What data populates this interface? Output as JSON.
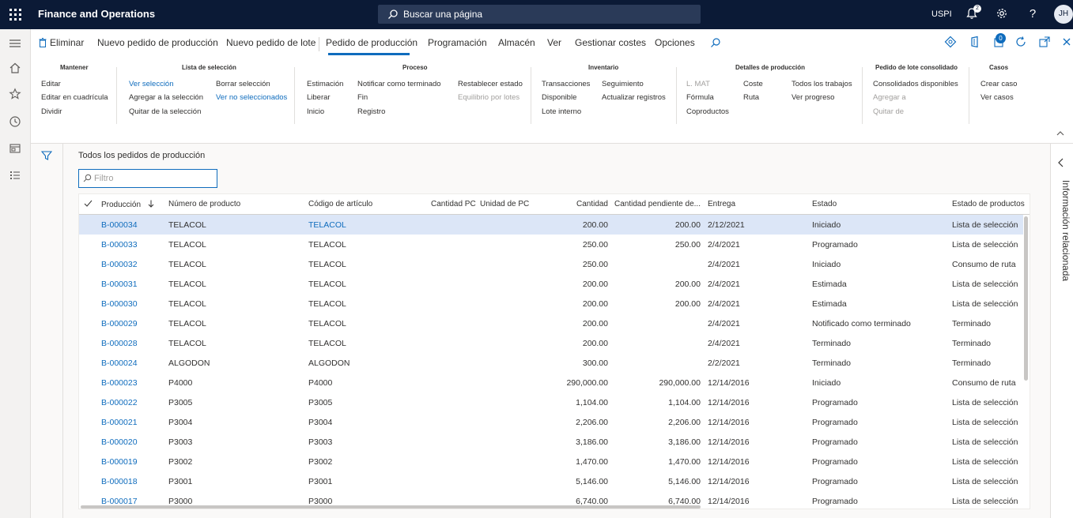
{
  "topbar": {
    "app_title": "Finance and Operations",
    "search_placeholder": "Buscar una página",
    "company": "USPI",
    "notification_count": "2",
    "avatar_initials": "JH"
  },
  "actionpane": {
    "tabs": [
      "Eliminar",
      "Nuevo pedido de producción",
      "Nuevo pedido de lote",
      "Pedido de producción",
      "Programación",
      "Almacén",
      "Ver",
      "Gestionar costes",
      "Opciones"
    ],
    "active_tab": "Pedido de producción",
    "badge_count": "0",
    "groups": {
      "mantener": {
        "title": "Mantener",
        "items": [
          "Editar",
          "Editar en cuadrícula",
          "Dividir"
        ]
      },
      "lista": {
        "title": "Lista de selección",
        "items": [
          "Ver selección",
          "Agregar a la selección",
          "Quitar de la selección",
          "Borrar selección",
          "Ver no seleccionados"
        ]
      },
      "proceso": {
        "title": "Proceso",
        "items": [
          "Estimación",
          "Liberar",
          "Inicio",
          "Notificar como terminado",
          "Fin",
          "Registro",
          "Restablecer estado",
          "Equilibrio por lotes"
        ]
      },
      "inventario": {
        "title": "Inventario",
        "items": [
          "Transacciones",
          "Disponible",
          "Lote interno",
          "Seguimiento",
          "Actualizar registros"
        ]
      },
      "detalles": {
        "title": "Detalles de producción",
        "items": [
          "L. MAT",
          "Fórmula",
          "Coproductos",
          "Coste",
          "Ruta",
          "Todos los trabajos",
          "Ver progreso"
        ]
      },
      "lote": {
        "title": "Pedido de lote consolidado",
        "items": [
          "Consolidados disponibles",
          "Agregar a",
          "Quitar de"
        ]
      },
      "casos": {
        "title": "Casos",
        "items": [
          "Crear caso",
          "Ver casos"
        ]
      }
    }
  },
  "content": {
    "list_title": "Todos los pedidos de producción",
    "filter_placeholder": "Filtro",
    "columns": [
      "Producción",
      "Número de producto",
      "Código de artículo",
      "Cantidad PC",
      "Unidad de PC",
      "Cantidad",
      "Cantidad pendiente de...",
      "Entrega",
      "Estado",
      "Estado de productos"
    ],
    "rows": [
      [
        "B-000034",
        "TELACOL",
        "TELACOL",
        "",
        "",
        "200.00",
        "200.00",
        "2/12/2021",
        "Iniciado",
        "Lista de selección"
      ],
      [
        "B-000033",
        "TELACOL",
        "TELACOL",
        "",
        "",
        "250.00",
        "250.00",
        "2/4/2021",
        "Programado",
        "Lista de selección"
      ],
      [
        "B-000032",
        "TELACOL",
        "TELACOL",
        "",
        "",
        "250.00",
        "",
        "2/4/2021",
        "Iniciado",
        "Consumo de ruta"
      ],
      [
        "B-000031",
        "TELACOL",
        "TELACOL",
        "",
        "",
        "200.00",
        "200.00",
        "2/4/2021",
        "Estimada",
        "Lista de selección"
      ],
      [
        "B-000030",
        "TELACOL",
        "TELACOL",
        "",
        "",
        "200.00",
        "200.00",
        "2/4/2021",
        "Estimada",
        "Lista de selección"
      ],
      [
        "B-000029",
        "TELACOL",
        "TELACOL",
        "",
        "",
        "200.00",
        "",
        "2/4/2021",
        "Notificado como terminado",
        "Terminado"
      ],
      [
        "B-000028",
        "TELACOL",
        "TELACOL",
        "",
        "",
        "200.00",
        "",
        "2/4/2021",
        "Terminado",
        "Terminado"
      ],
      [
        "B-000024",
        "ALGODON",
        "ALGODON",
        "",
        "",
        "300.00",
        "",
        "2/2/2021",
        "Terminado",
        "Terminado"
      ],
      [
        "B-000023",
        "P4000",
        "P4000",
        "",
        "",
        "290,000.00",
        "290,000.00",
        "12/14/2016",
        "Iniciado",
        "Consumo de ruta"
      ],
      [
        "B-000022",
        "P3005",
        "P3005",
        "",
        "",
        "1,104.00",
        "1,104.00",
        "12/14/2016",
        "Programado",
        "Lista de selección"
      ],
      [
        "B-000021",
        "P3004",
        "P3004",
        "",
        "",
        "2,206.00",
        "2,206.00",
        "12/14/2016",
        "Programado",
        "Lista de selección"
      ],
      [
        "B-000020",
        "P3003",
        "P3003",
        "",
        "",
        "3,186.00",
        "3,186.00",
        "12/14/2016",
        "Programado",
        "Lista de selección"
      ],
      [
        "B-000019",
        "P3002",
        "P3002",
        "",
        "",
        "1,470.00",
        "1,470.00",
        "12/14/2016",
        "Programado",
        "Lista de selección"
      ],
      [
        "B-000018",
        "P3001",
        "P3001",
        "",
        "",
        "5,146.00",
        "5,146.00",
        "12/14/2016",
        "Programado",
        "Lista de selección"
      ],
      [
        "B-000017",
        "P3000",
        "P3000",
        "",
        "",
        "6,740.00",
        "6,740.00",
        "12/14/2016",
        "Programado",
        "Lista de selección"
      ]
    ]
  },
  "related_info": {
    "label": "Información relacionada"
  }
}
